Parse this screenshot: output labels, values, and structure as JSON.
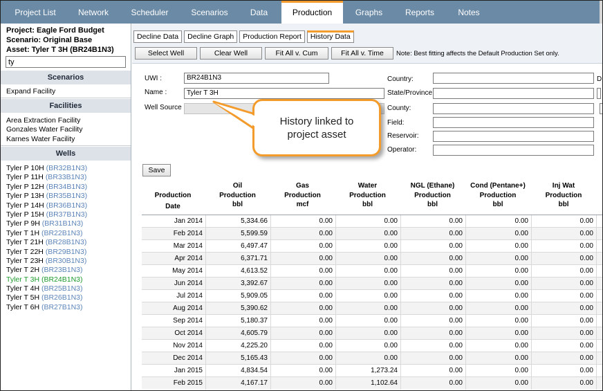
{
  "nav": {
    "tabs": [
      {
        "label": "Project List"
      },
      {
        "label": "Network"
      },
      {
        "label": "Scheduler"
      },
      {
        "label": "Scenarios"
      },
      {
        "label": "Data"
      },
      {
        "label": "Production"
      },
      {
        "label": "Graphs"
      },
      {
        "label": "Reports"
      },
      {
        "label": "Notes"
      }
    ],
    "active": "Production"
  },
  "sidebar": {
    "project": "Project: Eagle Ford Budget",
    "scenario": "Scenario: Original Base",
    "asset": "Asset: Tyler T 3H (BR24B1N3)",
    "search_value": "ty",
    "scenarios_title": "Scenarios",
    "scenarios": [
      "Expand Facility"
    ],
    "facilities_title": "Facilities",
    "facilities": [
      "Area Extraction Facility",
      "Gonzales Water Facility",
      "Karnes Water Facility"
    ],
    "wells_title": "Wells",
    "wells": [
      {
        "name": "Tyler P 10H",
        "code": "(BR32B1N3)"
      },
      {
        "name": "Tyler P 11H",
        "code": "(BR33B1N3)"
      },
      {
        "name": "Tyler P 12H",
        "code": "(BR34B1N3)"
      },
      {
        "name": "Tyler P 13H",
        "code": "(BR35B1N3)"
      },
      {
        "name": "Tyler P 14H",
        "code": "(BR36B1N3)"
      },
      {
        "name": "Tyler P 15H",
        "code": "(BR37B1N3)"
      },
      {
        "name": "Tyler P 9H",
        "code": "(BR31B1N3)"
      },
      {
        "name": "Tyler T 1H",
        "code": "(BR22B1N3)"
      },
      {
        "name": "Tyler T 21H",
        "code": "(BR28B1N3)"
      },
      {
        "name": "Tyler T 22H",
        "code": "(BR29B1N3)"
      },
      {
        "name": "Tyler T 23H",
        "code": "(BR30B1N3)"
      },
      {
        "name": "Tyler T 2H",
        "code": "(BR23B1N3)"
      },
      {
        "name": "Tyler T 3H",
        "code": "(BR24B1N3)"
      },
      {
        "name": "Tyler T 4H",
        "code": "(BR25B1N3)"
      },
      {
        "name": "Tyler T 5H",
        "code": "(BR26B1N3)"
      },
      {
        "name": "Tyler T 6H",
        "code": "(BR27B1N3)"
      }
    ],
    "selected_well": "Tyler T 3H"
  },
  "subtabs": [
    {
      "label": "Decline Data"
    },
    {
      "label": "Decline Graph"
    },
    {
      "label": "Production Report"
    },
    {
      "label": "History Data"
    }
  ],
  "subtab_active": "History Data",
  "toolbar": {
    "select_well": "Select Well",
    "clear_well": "Clear Well",
    "fit_all_cum": "Fit All v. Cum",
    "fit_all_time": "Fit All v. Time",
    "note": "Note: Best fitting affects the Default Production Set only."
  },
  "form": {
    "uwi_label": "UWI :",
    "uwi_value": "BR24B1N3",
    "name_label": "Name :",
    "name_value": "Tyler T 3H",
    "well_source_label": "Well Source :",
    "country_label": "Country:",
    "state_label": "State/Province:",
    "county_label": "County:",
    "field_label": "Field:",
    "reservoir_label": "Reservoir:",
    "operator_label": "Operator:",
    "cut_label": "D",
    "save_label": "Save"
  },
  "callout": {
    "line1": "History linked to",
    "line2": "project asset"
  },
  "table": {
    "headers": [
      [
        "Production",
        "Date"
      ],
      [
        "Oil",
        "Production",
        "bbl"
      ],
      [
        "Gas",
        "Production",
        "mcf"
      ],
      [
        "Water",
        "Production",
        "bbl"
      ],
      [
        "NGL (Ethane)",
        "Production",
        "bbl"
      ],
      [
        "Cond (Pentane+)",
        "Production",
        "bbl"
      ],
      [
        "Inj Wat",
        "Production",
        "bbl"
      ]
    ],
    "rows": [
      [
        "Jan 2014",
        "5,334.66",
        "0.00",
        "0.00",
        "0.00",
        "0.00",
        "0.00"
      ],
      [
        "Feb 2014",
        "5,599.59",
        "0.00",
        "0.00",
        "0.00",
        "0.00",
        "0.00"
      ],
      [
        "Mar 2014",
        "6,497.47",
        "0.00",
        "0.00",
        "0.00",
        "0.00",
        "0.00"
      ],
      [
        "Apr 2014",
        "6,371.71",
        "0.00",
        "0.00",
        "0.00",
        "0.00",
        "0.00"
      ],
      [
        "May 2014",
        "4,613.52",
        "0.00",
        "0.00",
        "0.00",
        "0.00",
        "0.00"
      ],
      [
        "Jun 2014",
        "3,392.67",
        "0.00",
        "0.00",
        "0.00",
        "0.00",
        "0.00"
      ],
      [
        "Jul 2014",
        "5,909.05",
        "0.00",
        "0.00",
        "0.00",
        "0.00",
        "0.00"
      ],
      [
        "Aug 2014",
        "5,390.62",
        "0.00",
        "0.00",
        "0.00",
        "0.00",
        "0.00"
      ],
      [
        "Sep 2014",
        "5,180.37",
        "0.00",
        "0.00",
        "0.00",
        "0.00",
        "0.00"
      ],
      [
        "Oct 2014",
        "4,605.79",
        "0.00",
        "0.00",
        "0.00",
        "0.00",
        "0.00"
      ],
      [
        "Nov 2014",
        "4,225.20",
        "0.00",
        "0.00",
        "0.00",
        "0.00",
        "0.00"
      ],
      [
        "Dec 2014",
        "5,165.43",
        "0.00",
        "0.00",
        "0.00",
        "0.00",
        "0.00"
      ],
      [
        "Jan 2015",
        "4,834.54",
        "0.00",
        "1,273.24",
        "0.00",
        "0.00",
        "0.00"
      ],
      [
        "Feb 2015",
        "4,167.17",
        "0.00",
        "1,102.64",
        "0.00",
        "0.00",
        "0.00"
      ]
    ]
  },
  "colors": {
    "nav_bg": "#6b8aa6",
    "accent": "#f39b2b",
    "selected_well": "#1d9a2d",
    "code_link": "#5c84b8"
  }
}
